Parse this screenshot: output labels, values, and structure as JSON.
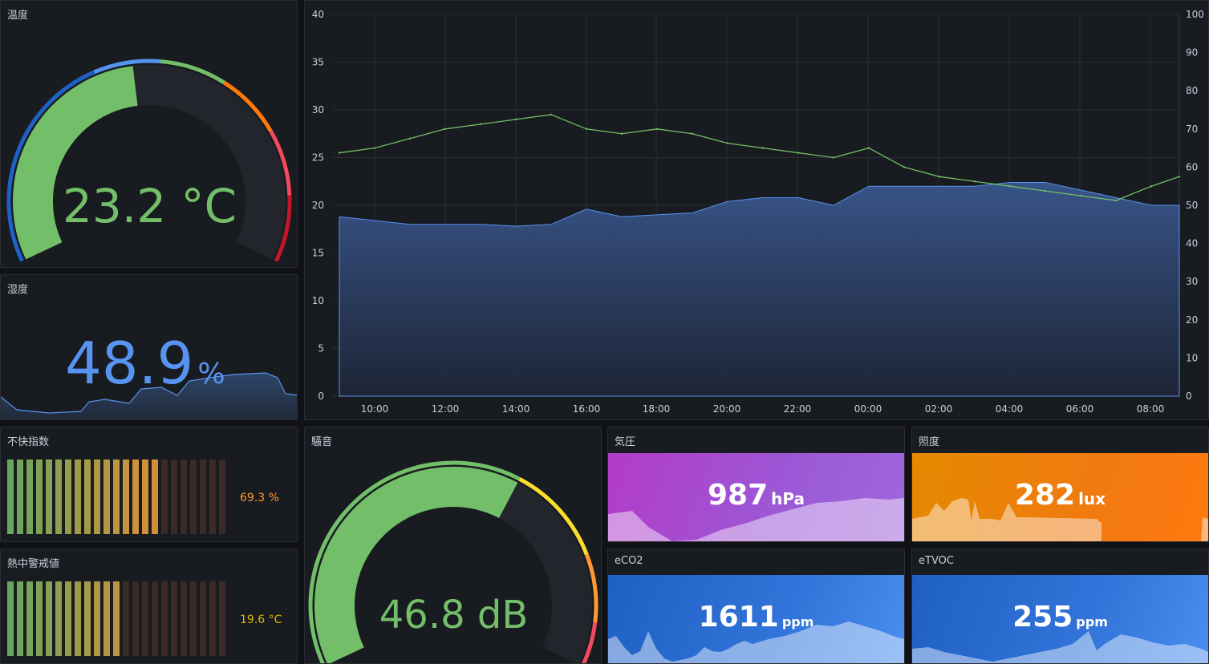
{
  "colors": {
    "green": "#73bf69",
    "blue": "#5794f2",
    "orange": "#ff9830",
    "red": "#f2495c",
    "yellow": "#fade2a",
    "dark_red": "#c4162a",
    "panel_bg": "#181b1f",
    "purple": "#b877d9",
    "amber": "#ff780a"
  },
  "temperature_gauge": {
    "title": "温度",
    "value": "23.2 °C",
    "fraction": 0.47,
    "min": 0,
    "max": 40
  },
  "humidity": {
    "title": "湿度",
    "value": "48.9",
    "unit": "%"
  },
  "main_chart": {
    "left_ticks": [
      "40",
      "35",
      "30",
      "25",
      "20",
      "15",
      "10",
      "5",
      "0"
    ],
    "right_ticks": [
      "100",
      "90",
      "80",
      "70",
      "60",
      "50",
      "40",
      "30",
      "20",
      "10",
      "0"
    ],
    "x_ticks": [
      "10:00",
      "12:00",
      "14:00",
      "16:00",
      "18:00",
      "20:00",
      "22:00",
      "00:00",
      "02:00",
      "04:00",
      "06:00",
      "08:00"
    ]
  },
  "chart_data": {
    "type": "line",
    "x": [
      "09:00",
      "10:00",
      "11:00",
      "12:00",
      "13:00",
      "14:00",
      "15:00",
      "16:00",
      "17:00",
      "18:00",
      "19:00",
      "20:00",
      "21:00",
      "22:00",
      "23:00",
      "00:00",
      "01:00",
      "02:00",
      "03:00",
      "04:00",
      "05:00",
      "06:00",
      "07:00",
      "08:00",
      "08:45"
    ],
    "series": [
      {
        "axis": "left",
        "color": "#73bf69",
        "values": [
          25.5,
          26,
          27,
          28,
          28.5,
          29,
          29.5,
          28,
          27.5,
          28,
          27.5,
          26.5,
          26,
          25.5,
          25,
          26,
          24,
          23,
          22.5,
          22,
          21.5,
          21,
          20.5,
          22,
          23
        ]
      },
      {
        "axis": "right",
        "color": "#5794f2",
        "values": [
          47,
          46,
          45,
          45,
          45,
          44.5,
          45,
          49,
          47,
          47.5,
          48,
          51,
          52,
          52,
          50,
          55,
          55,
          55,
          55,
          56,
          56,
          54,
          52,
          50,
          50
        ]
      }
    ],
    "ylim_left": [
      0,
      40
    ],
    "ylim_right": [
      0,
      100
    ]
  },
  "discomfort": {
    "title": "不快指数",
    "value": "69.3 %",
    "fraction": 0.69
  },
  "heat": {
    "title": "熱中警戒値",
    "value": "19.6 °C",
    "fraction": 0.52
  },
  "noise_gauge": {
    "title": "騒音",
    "value": "46.8 dB",
    "fraction": 0.62
  },
  "pressure": {
    "title": "気圧",
    "value": "987",
    "unit": "hPa"
  },
  "illuminance": {
    "title": "照度",
    "value": "282",
    "unit": "lux"
  },
  "eco2": {
    "title": "eCO2",
    "value": "1611",
    "unit": "ppm"
  },
  "etvoc": {
    "title": "eTVOC",
    "value": "255",
    "unit": "ppm"
  }
}
